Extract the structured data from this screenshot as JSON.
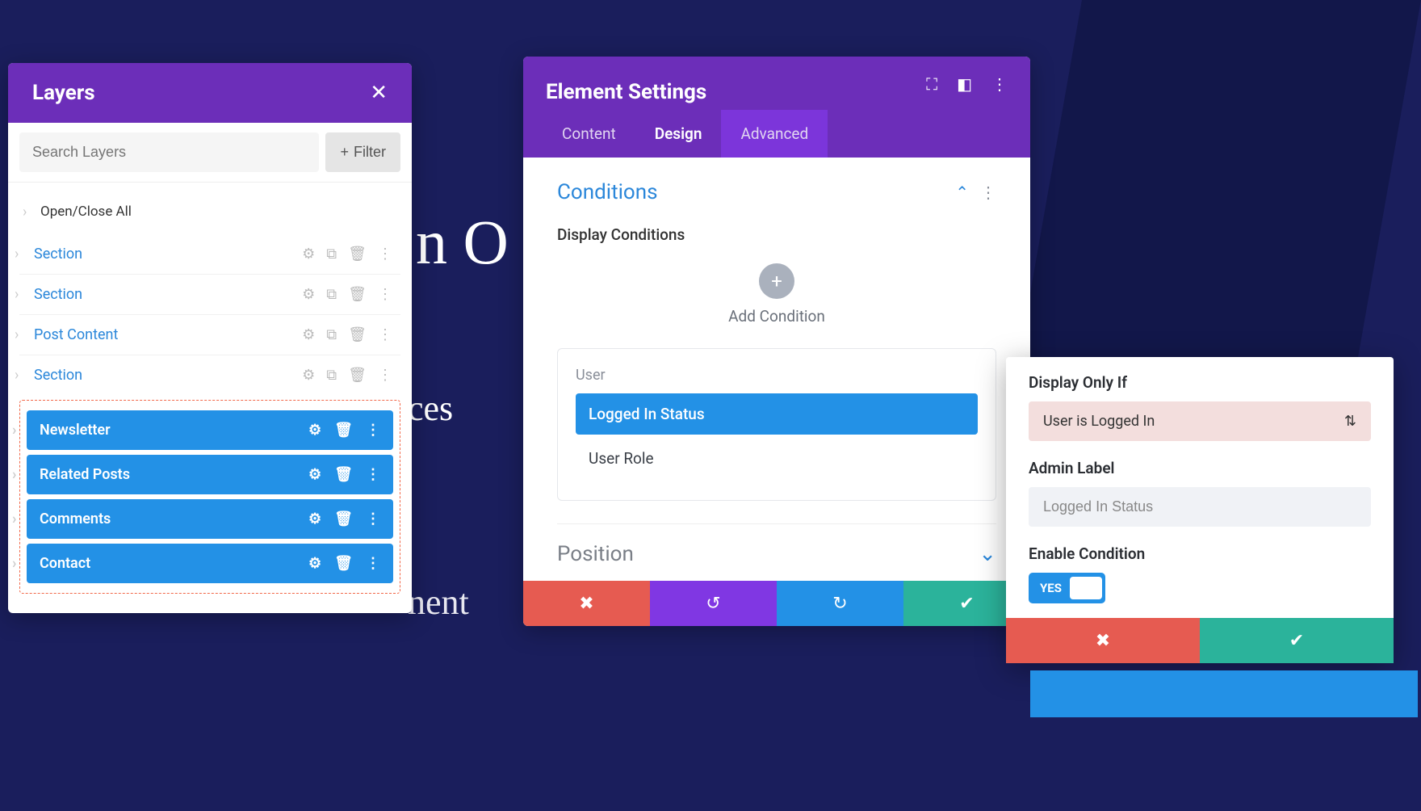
{
  "background": {
    "big_text": "n O      r",
    "text2": "ces",
    "text3": "nent"
  },
  "layers_panel": {
    "title": "Layers",
    "search_placeholder": "Search Layers",
    "filter_label": "Filter",
    "open_close_label": "Open/Close All",
    "items": [
      {
        "label": "Section"
      },
      {
        "label": "Section"
      },
      {
        "label": "Post Content"
      },
      {
        "label": "Section"
      }
    ],
    "selected_items": [
      {
        "label": "Newsletter"
      },
      {
        "label": "Related Posts"
      },
      {
        "label": "Comments"
      },
      {
        "label": "Contact"
      }
    ]
  },
  "settings_panel": {
    "title": "Element Settings",
    "tabs": {
      "content": "Content",
      "design": "Design",
      "advanced": "Advanced"
    },
    "conditions": {
      "title": "Conditions",
      "display_label": "Display Conditions",
      "add_label": "Add Condition",
      "group_label": "User",
      "options": [
        {
          "label": "Logged In Status",
          "active": true
        },
        {
          "label": "User Role",
          "active": false
        }
      ]
    },
    "position_title": "Position"
  },
  "condition_detail": {
    "display_only_label": "Display Only If",
    "display_only_value": "User is Logged In",
    "admin_label_label": "Admin Label",
    "admin_label_value": "Logged In Status",
    "enable_label": "Enable Condition",
    "toggle_text": "YES"
  }
}
